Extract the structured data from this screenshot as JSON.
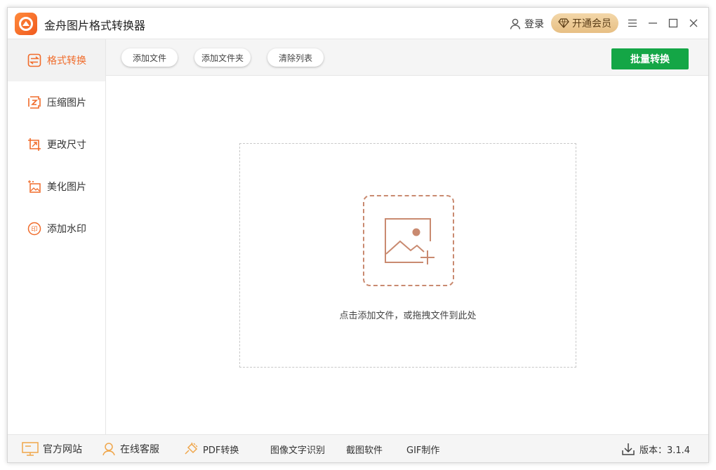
{
  "app": {
    "title": "金舟图片格式转换器"
  },
  "header": {
    "login_label": "登录",
    "vip_label": "开通会员"
  },
  "sidebar": {
    "items": [
      {
        "label": "格式转换",
        "icon": "convert-icon",
        "active": true
      },
      {
        "label": "压缩图片",
        "icon": "compress-icon",
        "active": false
      },
      {
        "label": "更改尺寸",
        "icon": "resize-icon",
        "active": false
      },
      {
        "label": "美化图片",
        "icon": "beautify-icon",
        "active": false
      },
      {
        "label": "添加水印",
        "icon": "watermark-icon",
        "active": false
      }
    ]
  },
  "toolbar": {
    "add_file": "添加文件",
    "add_folder": "添加文件夹",
    "clear_list": "清除列表",
    "batch_convert": "批量转换"
  },
  "dropzone": {
    "hint": "点击添加文件，或拖拽文件到此处",
    "icon": "add-image-icon"
  },
  "footer": {
    "website": "官方网站",
    "support": "在线客服",
    "pdf": "PDF转换",
    "ocr": "图像文字识别",
    "screenshot": "截图软件",
    "gif": "GIF制作",
    "version_label": "版本：3.1.4"
  },
  "colors": {
    "accent": "#f06b2a",
    "green": "#14a646",
    "vip_gold": "#e7bf84",
    "drop_icon": "#c98a70"
  }
}
